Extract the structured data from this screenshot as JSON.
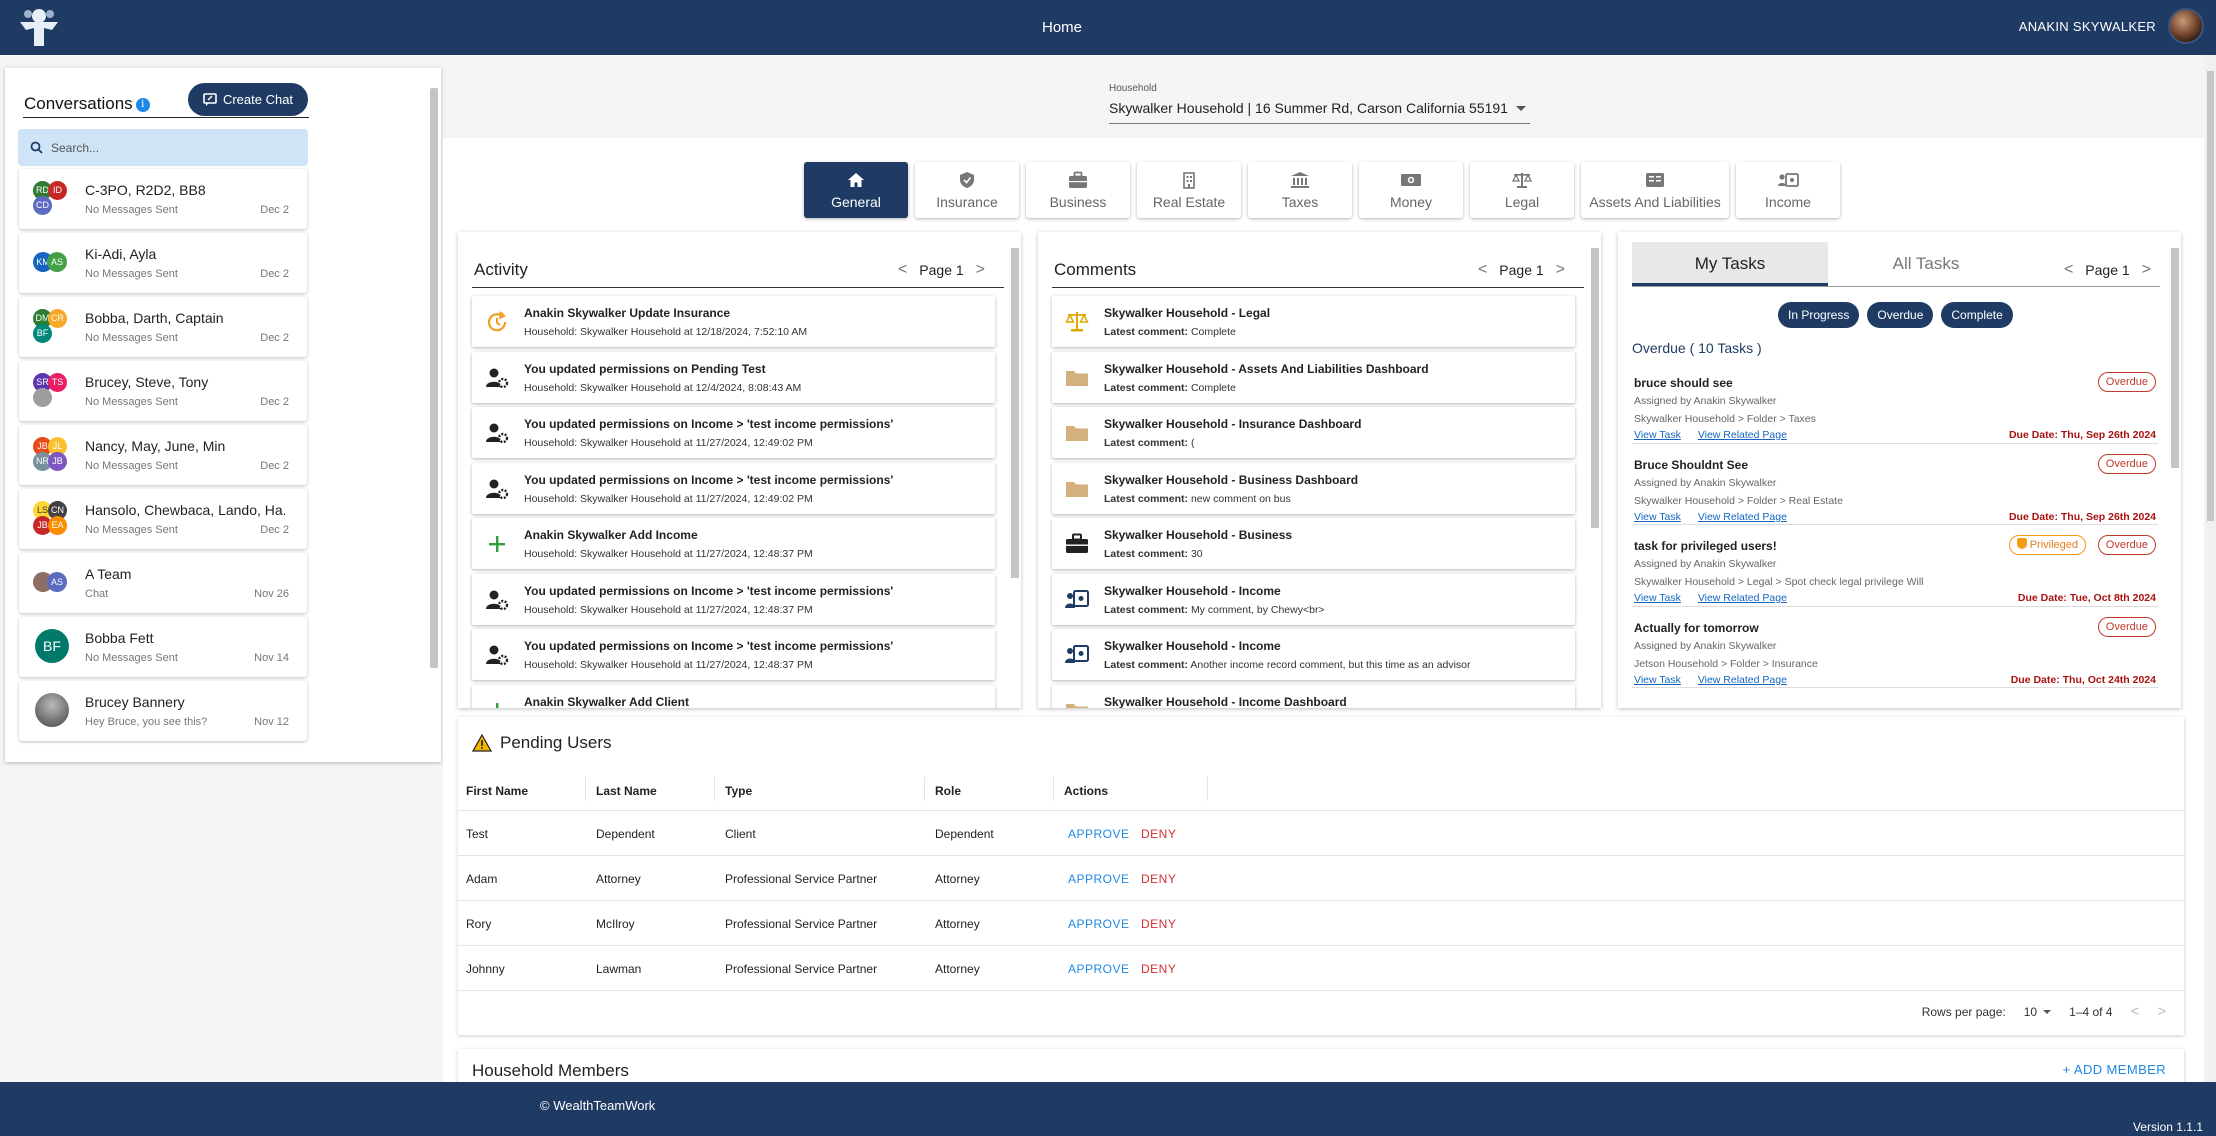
{
  "header": {
    "title": "Home",
    "user_name": "ANAKIN SKYWALKER"
  },
  "conversations": {
    "title": "Conversations",
    "create_label": "Create Chat",
    "search_placeholder": "Search...",
    "items": [
      {
        "name": "C-3PO, R2D2, BB8",
        "sub": "No Messages Sent",
        "date": "Dec 2"
      },
      {
        "name": "Ki-Adi, Ayla",
        "sub": "No Messages Sent",
        "date": "Dec 2"
      },
      {
        "name": "Bobba, Darth, Captain",
        "sub": "No Messages Sent",
        "date": "Dec 2"
      },
      {
        "name": "Brucey, Steve, Tony",
        "sub": "No Messages Sent",
        "date": "Dec 2"
      },
      {
        "name": "Nancy, May, June, Min",
        "sub": "No Messages Sent",
        "date": "Dec 2"
      },
      {
        "name": "Hansolo, Chewbaca, Lando, Ha...",
        "sub": "No Messages Sent",
        "date": "Dec 2"
      },
      {
        "name": "A Team",
        "sub": "Chat",
        "date": "Nov 26"
      },
      {
        "name": "Bobba Fett",
        "sub": "No Messages Sent",
        "date": "Nov 14"
      },
      {
        "name": "Brucey Bannery",
        "sub": "Hey Bruce, you see this?",
        "date": "Nov 12"
      }
    ]
  },
  "household": {
    "label": "Household",
    "value": "Skywalker Household | 16 Summer Rd, Carson California 55191"
  },
  "tabs": [
    {
      "label": "General",
      "icon": "home-icon"
    },
    {
      "label": "Insurance",
      "icon": "shield-icon"
    },
    {
      "label": "Business",
      "icon": "briefcase-icon"
    },
    {
      "label": "Real Estate",
      "icon": "building-icon"
    },
    {
      "label": "Taxes",
      "icon": "bank-icon"
    },
    {
      "label": "Money",
      "icon": "money-icon"
    },
    {
      "label": "Legal",
      "icon": "scale-icon"
    },
    {
      "label": "Assets And Liabilities",
      "icon": "ledger-icon"
    },
    {
      "label": "Income",
      "icon": "income-icon"
    }
  ],
  "activity": {
    "title": "Activity",
    "page": "Page 1",
    "items": [
      {
        "title": "Anakin Skywalker Update Insurance",
        "sub": "Household: Skywalker Household at 12/18/2024, 7:52:10 AM",
        "icon": "update-icon"
      },
      {
        "title": "You updated permissions on Pending Test",
        "sub": "Household: Skywalker Household at 12/4/2024, 8:08:43 AM",
        "icon": "user-gear-icon"
      },
      {
        "title": "You updated permissions on Income > 'test income permissions'",
        "sub": "Household: Skywalker Household at 11/27/2024, 12:49:02 PM",
        "icon": "user-gear-icon"
      },
      {
        "title": "You updated permissions on Income > 'test income permissions'",
        "sub": "Household: Skywalker Household at 11/27/2024, 12:49:02 PM",
        "icon": "user-gear-icon"
      },
      {
        "title": "Anakin Skywalker Add Income",
        "sub": "Household: Skywalker Household at 11/27/2024, 12:48:37 PM",
        "icon": "plus-icon"
      },
      {
        "title": "You updated permissions on Income > 'test income permissions'",
        "sub": "Household: Skywalker Household at 11/27/2024, 12:48:37 PM",
        "icon": "user-gear-icon"
      },
      {
        "title": "You updated permissions on Income > 'test income permissions'",
        "sub": "Household: Skywalker Household at 11/27/2024, 12:48:37 PM",
        "icon": "user-gear-icon"
      },
      {
        "title": "Anakin Skywalker Add Client",
        "sub": "",
        "icon": "plus-icon"
      }
    ]
  },
  "comments": {
    "title": "Comments",
    "page": "Page 1",
    "latest_label": "Latest comment:",
    "items": [
      {
        "title": "Skywalker Household - Legal",
        "comment": "Complete",
        "icon": "scale-icon"
      },
      {
        "title": "Skywalker Household - Assets And Liabilities Dashboard",
        "comment": "Complete",
        "icon": "folder-icon"
      },
      {
        "title": "Skywalker Household - Insurance Dashboard",
        "comment": "(",
        "icon": "folder-icon"
      },
      {
        "title": "Skywalker Household - Business Dashboard",
        "comment": "new comment on bus",
        "icon": "folder-icon"
      },
      {
        "title": "Skywalker Household - Business",
        "comment": "30",
        "icon": "briefcase-icon"
      },
      {
        "title": "Skywalker Household - Income",
        "comment": "My comment, by Chewy<br>",
        "icon": "income-icon"
      },
      {
        "title": "Skywalker Household - Income",
        "comment": "Another income record comment, but this time as an advisor",
        "icon": "income-icon"
      },
      {
        "title": "Skywalker Household - Income Dashboard",
        "comment": "",
        "icon": "folder-icon"
      }
    ]
  },
  "tasks": {
    "tab_mine": "My Tasks",
    "tab_all": "All Tasks",
    "page": "Page 1",
    "filters": [
      "In Progress",
      "Overdue",
      "Complete"
    ],
    "overdue_heading": "Overdue ( 10 Tasks )",
    "view_task": "View Task",
    "view_related": "View Related Page",
    "items": [
      {
        "title": "bruce should see",
        "assigned": "Assigned by Anakin Skywalker",
        "path": "Skywalker Household > Folder > Taxes",
        "due": "Due Date: Thu, Sep 26th 2024",
        "status": "Overdue",
        "privileged": ""
      },
      {
        "title": "Bruce Shouldnt See",
        "assigned": "Assigned by Anakin Skywalker",
        "path": "Skywalker Household > Folder > Real Estate",
        "due": "Due Date: Thu, Sep 26th 2024",
        "status": "Overdue",
        "privileged": ""
      },
      {
        "title": "task for privileged users!",
        "assigned": "Assigned by Anakin Skywalker",
        "path": "Skywalker Household > Legal > Spot check legal privilege Will",
        "due": "Due Date: Tue, Oct 8th 2024",
        "status": "Overdue",
        "privileged": "Privileged"
      },
      {
        "title": "Actually for tomorrow",
        "assigned": "Assigned by Anakin Skywalker",
        "path": "Jetson Household > Folder > Insurance",
        "due": "Due Date: Thu, Oct 24th 2024",
        "status": "Overdue",
        "privileged": ""
      }
    ]
  },
  "pending": {
    "title": "Pending Users",
    "columns": [
      "First Name",
      "Last Name",
      "Type",
      "Role",
      "Actions"
    ],
    "approve_label": "APPROVE",
    "deny_label": "DENY",
    "rows": [
      {
        "first": "Test",
        "last": "Dependent",
        "type": "Client",
        "role": "Dependent"
      },
      {
        "first": "Adam",
        "last": "Attorney",
        "type": "Professional Service Partner",
        "role": "Attorney"
      },
      {
        "first": "Rory",
        "last": "McIlroy",
        "type": "Professional Service Partner",
        "role": "Attorney"
      },
      {
        "first": "Johnny",
        "last": "Lawman",
        "type": "Professional Service Partner",
        "role": "Attorney"
      }
    ],
    "rows_per_page_label": "Rows per page:",
    "rows_per_page": "10",
    "range": "1–4 of 4"
  },
  "members": {
    "title": "Household Members",
    "add_label": "ADD MEMBER"
  },
  "footer": {
    "copyright": "© WealthTeamWork",
    "version": "Version 1.1.1"
  },
  "colors": {
    "navy": "#1f3b64",
    "link_blue": "#1e88e5",
    "deny_red": "#d32f2f",
    "overdue_red": "#c0392b",
    "privileged_orange": "#f39c12"
  }
}
